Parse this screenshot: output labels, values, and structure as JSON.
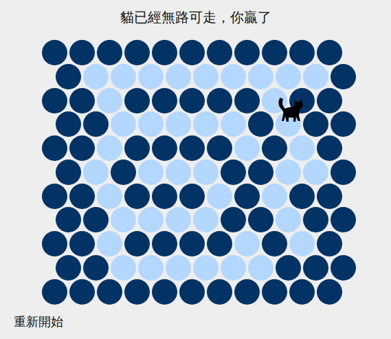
{
  "status_text": "貓已經無路可走，你贏了",
  "board": {
    "rows": [
      [
        {
          "blocked": true,
          "cat": false
        },
        {
          "blocked": true,
          "cat": false
        },
        {
          "blocked": true,
          "cat": false
        },
        {
          "blocked": true,
          "cat": false
        },
        {
          "blocked": true,
          "cat": false
        },
        {
          "blocked": true,
          "cat": false
        },
        {
          "blocked": true,
          "cat": false
        },
        {
          "blocked": true,
          "cat": false
        },
        {
          "blocked": true,
          "cat": false
        },
        {
          "blocked": true,
          "cat": false
        },
        {
          "blocked": true,
          "cat": false
        }
      ],
      [
        {
          "blocked": true,
          "cat": false
        },
        {
          "blocked": false,
          "cat": false
        },
        {
          "blocked": false,
          "cat": false
        },
        {
          "blocked": false,
          "cat": false
        },
        {
          "blocked": false,
          "cat": false
        },
        {
          "blocked": false,
          "cat": false
        },
        {
          "blocked": false,
          "cat": false
        },
        {
          "blocked": false,
          "cat": false
        },
        {
          "blocked": false,
          "cat": false
        },
        {
          "blocked": false,
          "cat": false
        },
        {
          "blocked": true,
          "cat": false
        }
      ],
      [
        {
          "blocked": true,
          "cat": false
        },
        {
          "blocked": true,
          "cat": false
        },
        {
          "blocked": false,
          "cat": false
        },
        {
          "blocked": true,
          "cat": false
        },
        {
          "blocked": true,
          "cat": false
        },
        {
          "blocked": true,
          "cat": false
        },
        {
          "blocked": true,
          "cat": false
        },
        {
          "blocked": true,
          "cat": false
        },
        {
          "blocked": false,
          "cat": false
        },
        {
          "blocked": true,
          "cat": false
        },
        {
          "blocked": true,
          "cat": false
        }
      ],
      [
        {
          "blocked": true,
          "cat": false
        },
        {
          "blocked": true,
          "cat": false
        },
        {
          "blocked": false,
          "cat": false
        },
        {
          "blocked": false,
          "cat": false
        },
        {
          "blocked": false,
          "cat": false
        },
        {
          "blocked": false,
          "cat": false
        },
        {
          "blocked": false,
          "cat": false
        },
        {
          "blocked": true,
          "cat": false
        },
        {
          "blocked": false,
          "cat": true
        },
        {
          "blocked": true,
          "cat": false
        },
        {
          "blocked": true,
          "cat": false
        }
      ],
      [
        {
          "blocked": true,
          "cat": false
        },
        {
          "blocked": true,
          "cat": false
        },
        {
          "blocked": false,
          "cat": false
        },
        {
          "blocked": true,
          "cat": false
        },
        {
          "blocked": true,
          "cat": false
        },
        {
          "blocked": true,
          "cat": false
        },
        {
          "blocked": true,
          "cat": false
        },
        {
          "blocked": false,
          "cat": false
        },
        {
          "blocked": true,
          "cat": false
        },
        {
          "blocked": false,
          "cat": false
        },
        {
          "blocked": true,
          "cat": false
        }
      ],
      [
        {
          "blocked": true,
          "cat": false
        },
        {
          "blocked": false,
          "cat": false
        },
        {
          "blocked": true,
          "cat": false
        },
        {
          "blocked": false,
          "cat": false
        },
        {
          "blocked": false,
          "cat": false
        },
        {
          "blocked": false,
          "cat": false
        },
        {
          "blocked": true,
          "cat": false
        },
        {
          "blocked": true,
          "cat": false
        },
        {
          "blocked": false,
          "cat": false
        },
        {
          "blocked": false,
          "cat": false
        },
        {
          "blocked": true,
          "cat": false
        }
      ],
      [
        {
          "blocked": true,
          "cat": false
        },
        {
          "blocked": true,
          "cat": false
        },
        {
          "blocked": false,
          "cat": false
        },
        {
          "blocked": true,
          "cat": false
        },
        {
          "blocked": true,
          "cat": false
        },
        {
          "blocked": true,
          "cat": false
        },
        {
          "blocked": false,
          "cat": false
        },
        {
          "blocked": true,
          "cat": false
        },
        {
          "blocked": false,
          "cat": false
        },
        {
          "blocked": true,
          "cat": false
        },
        {
          "blocked": true,
          "cat": false
        }
      ],
      [
        {
          "blocked": true,
          "cat": false
        },
        {
          "blocked": true,
          "cat": false
        },
        {
          "blocked": false,
          "cat": false
        },
        {
          "blocked": false,
          "cat": false
        },
        {
          "blocked": false,
          "cat": false
        },
        {
          "blocked": false,
          "cat": false
        },
        {
          "blocked": true,
          "cat": false
        },
        {
          "blocked": true,
          "cat": false
        },
        {
          "blocked": false,
          "cat": false
        },
        {
          "blocked": true,
          "cat": false
        },
        {
          "blocked": true,
          "cat": false
        }
      ],
      [
        {
          "blocked": true,
          "cat": false
        },
        {
          "blocked": true,
          "cat": false
        },
        {
          "blocked": false,
          "cat": false
        },
        {
          "blocked": true,
          "cat": false
        },
        {
          "blocked": true,
          "cat": false
        },
        {
          "blocked": true,
          "cat": false
        },
        {
          "blocked": true,
          "cat": false
        },
        {
          "blocked": false,
          "cat": false
        },
        {
          "blocked": true,
          "cat": false
        },
        {
          "blocked": false,
          "cat": false
        },
        {
          "blocked": true,
          "cat": false
        }
      ],
      [
        {
          "blocked": true,
          "cat": false
        },
        {
          "blocked": true,
          "cat": false
        },
        {
          "blocked": false,
          "cat": false
        },
        {
          "blocked": false,
          "cat": false
        },
        {
          "blocked": false,
          "cat": false
        },
        {
          "blocked": false,
          "cat": false
        },
        {
          "blocked": false,
          "cat": false
        },
        {
          "blocked": false,
          "cat": false
        },
        {
          "blocked": true,
          "cat": false
        },
        {
          "blocked": true,
          "cat": false
        },
        {
          "blocked": true,
          "cat": false
        }
      ],
      [
        {
          "blocked": true,
          "cat": false
        },
        {
          "blocked": true,
          "cat": false
        },
        {
          "blocked": true,
          "cat": false
        },
        {
          "blocked": true,
          "cat": false
        },
        {
          "blocked": true,
          "cat": false
        },
        {
          "blocked": true,
          "cat": false
        },
        {
          "blocked": true,
          "cat": false
        },
        {
          "blocked": true,
          "cat": false
        },
        {
          "blocked": true,
          "cat": false
        },
        {
          "blocked": true,
          "cat": false
        },
        {
          "blocked": true,
          "cat": false
        }
      ]
    ]
  },
  "restart_button": "重新開始"
}
